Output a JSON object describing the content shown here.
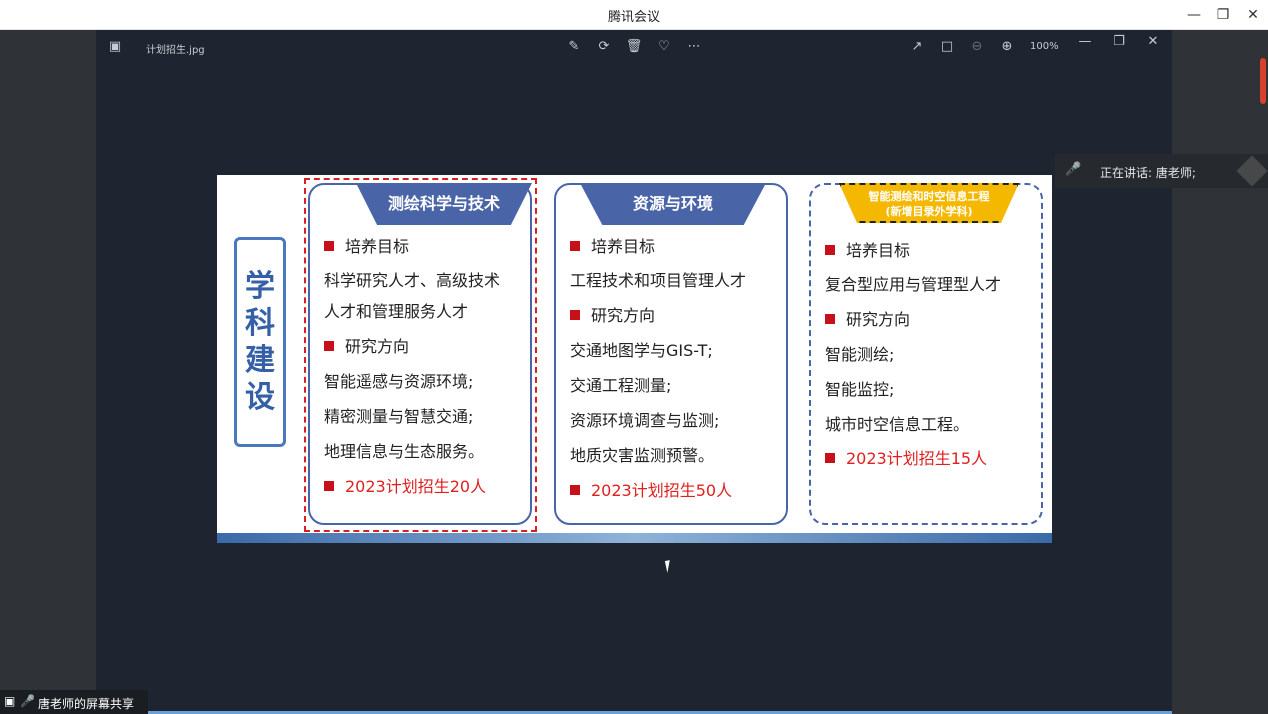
{
  "window": {
    "title": "腾讯会议"
  },
  "viewer": {
    "filename": "计划招生.jpg",
    "zoom": "100%"
  },
  "speaker": {
    "text": "正在讲话: 唐老师;"
  },
  "share": {
    "label": "唐老师的屏幕共享"
  },
  "slide": {
    "side_label": [
      "学",
      "科",
      "建",
      "设"
    ],
    "cards": [
      {
        "title": "测绘科学与技术",
        "items": [
          {
            "text": "培养目标",
            "bullet": true
          },
          {
            "text": "科学研究人才、高级技术",
            "bullet": false
          },
          {
            "text": "人才和管理服务人才",
            "bullet": false
          },
          {
            "text": "研究方向",
            "bullet": true
          },
          {
            "text": "智能遥感与资源环境;",
            "bullet": false
          },
          {
            "text": "精密测量与智慧交通;",
            "bullet": false
          },
          {
            "text": "地理信息与生态服务。",
            "bullet": false
          },
          {
            "text": "2023计划招生20人",
            "bullet": true,
            "red": true
          }
        ]
      },
      {
        "title": "资源与环境",
        "items": [
          {
            "text": "培养目标",
            "bullet": true
          },
          {
            "text": "工程技术和项目管理人才",
            "bullet": false
          },
          {
            "text": "研究方向",
            "bullet": true
          },
          {
            "text": "交通地图学与GIS-T;",
            "bullet": false
          },
          {
            "text": "交通工程测量;",
            "bullet": false
          },
          {
            "text": "资源环境调查与监测;",
            "bullet": false
          },
          {
            "text": "地质灾害监测预警。",
            "bullet": false
          },
          {
            "text": "2023计划招生50人",
            "bullet": true,
            "red": true
          }
        ]
      },
      {
        "title_line1": "智能测绘和时空信息工程",
        "title_line2": "(新增目录外学科)",
        "items": [
          {
            "text": "培养目标",
            "bullet": true
          },
          {
            "text": "复合型应用与管理型人才",
            "bullet": false
          },
          {
            "text": "研究方向",
            "bullet": true
          },
          {
            "text": "智能测绘;",
            "bullet": false
          },
          {
            "text": "智能监控;",
            "bullet": false
          },
          {
            "text": "城市时空信息工程。",
            "bullet": false
          },
          {
            "text": "2023计划招生15人",
            "bullet": true,
            "red": true
          }
        ]
      }
    ]
  }
}
